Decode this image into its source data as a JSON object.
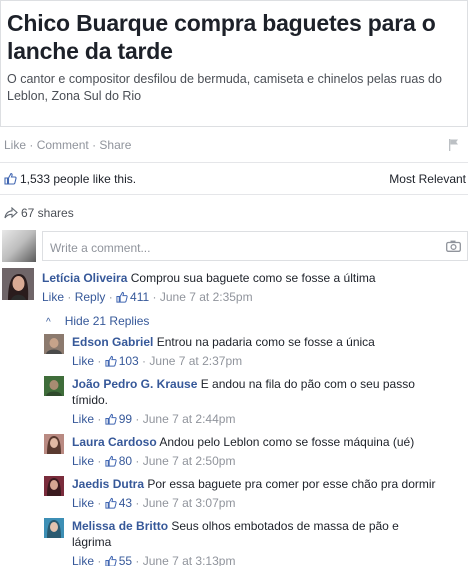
{
  "link": {
    "title": "Chico Buarque compra baguetes para o lanche da tarde",
    "description": "O cantor e compositor desfilou de bermuda, camiseta e chinelos pelas ruas do Leblon, Zona Sul do Rio"
  },
  "actions": {
    "like": "Like",
    "comment": "Comment",
    "share": "Share",
    "sep": "·"
  },
  "reactions": {
    "likes_text": "1,533 people like this.",
    "sort": "Most Relevant"
  },
  "shares": {
    "text": "67 shares"
  },
  "composer": {
    "placeholder": "Write a comment..."
  },
  "top_comment": {
    "name": "Letícia Oliveira",
    "text": "Comprou sua baguete como se fosse a última",
    "like": "Like",
    "reply": "Reply",
    "count": "411",
    "time": "June 7 at 2:35pm"
  },
  "hide_replies": "Hide 21 Replies",
  "replies": [
    {
      "name": "Edson Gabriel",
      "text": "Entrou na padaria como se fosse a única",
      "like": "Like",
      "count": "103",
      "time": "June 7 at 2:37pm"
    },
    {
      "name": "João Pedro G. Krause",
      "text": "E andou na fila do pão com o seu passo tímido.",
      "like": "Like",
      "count": "99",
      "time": "June 7 at 2:44pm"
    },
    {
      "name": "Laura Cardoso",
      "text": "Andou pelo Leblon como se fosse máquina (ué)",
      "like": "Like",
      "count": "80",
      "time": "June 7 at 2:50pm"
    },
    {
      "name": "Jaedis Dutra",
      "text": "Por essa baguete pra comer por esse chão pra dormir",
      "like": "Like",
      "count": "43",
      "time": "June 7 at 3:07pm"
    },
    {
      "name": "Melissa de Britto",
      "text": "Seus olhos embotados de massa de pão e lágrima",
      "like": "Like",
      "count": "55",
      "time": "June 7 at 3:13pm"
    }
  ],
  "icons": {
    "flag": "flag-icon",
    "thumb": "thumbs-up-icon",
    "share": "share-arrow-icon",
    "camera": "camera-icon",
    "chevron": "chevron-up-icon"
  },
  "colors": {
    "link": "#365899",
    "muted": "#90949c",
    "text": "#1d2129",
    "border": "#dddfe2"
  }
}
